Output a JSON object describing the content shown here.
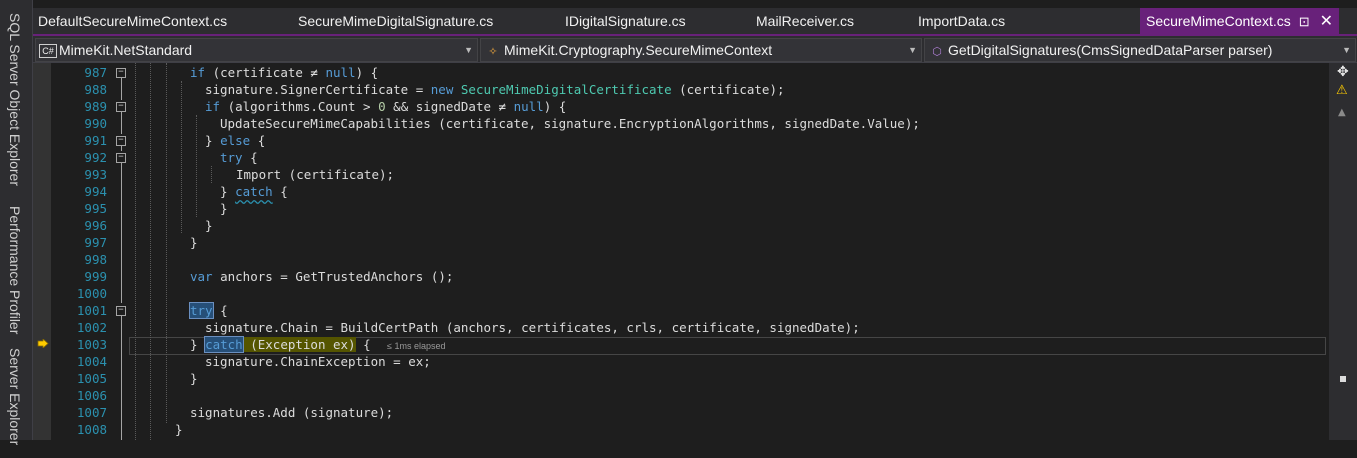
{
  "side_panel": {
    "tabs": [
      "SQL Server Object Explorer",
      "Performance Profiler",
      "Server Explorer"
    ]
  },
  "tabs": [
    {
      "label": "DefaultSecureMimeContext.cs",
      "active": false
    },
    {
      "label": "SecureMimeDigitalSignature.cs",
      "active": false
    },
    {
      "label": "IDigitalSignature.cs",
      "active": false
    },
    {
      "label": "MailReceiver.cs",
      "active": false
    },
    {
      "label": "ImportData.cs",
      "active": false
    },
    {
      "label": "SecureMimeContext.cs",
      "active": true
    }
  ],
  "navbar": {
    "project": "MimeKit.NetStandard",
    "project_icon": "C#",
    "type": "MimeKit.Cryptography.SecureMimeContext",
    "member": "GetDigitalSignatures(CmsSignedDataParser parser)"
  },
  "editor": {
    "line_numbers": [
      "987",
      "988",
      "989",
      "990",
      "991",
      "992",
      "993",
      "994",
      "995",
      "996",
      "997",
      "998",
      "999",
      "1000",
      "1001",
      "1002",
      "1003",
      "1004",
      "1005",
      "1006",
      "1007",
      "1008"
    ],
    "current_line": "1003",
    "perf_tip": "≤ 1ms elapsed"
  },
  "colors": {
    "accent": "#68217a",
    "keyword": "#569cd6",
    "type": "#4ec9b0",
    "line_number": "#2b91af",
    "statement_highlight": "#555500",
    "selection": "#264f78"
  },
  "icons": [
    "csharp-project-icon",
    "class-icon",
    "method-icon",
    "pin-icon",
    "close-icon",
    "current-statement-arrow-icon",
    "split-icon",
    "warning-icon",
    "scroll-up-icon"
  ]
}
